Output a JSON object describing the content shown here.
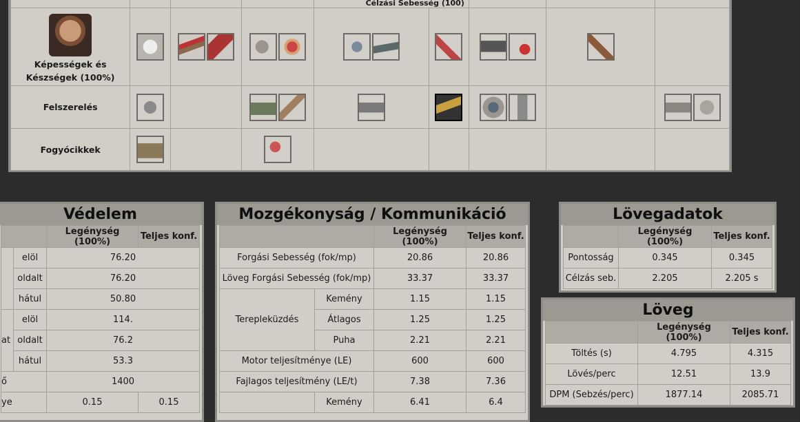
{
  "top_table": {
    "partial_header": "Célzási Sebesség (100)",
    "rows": [
      {
        "label": "Képességek és Készségek (100%)"
      },
      {
        "label": "Felszerelés"
      },
      {
        "label": "Fogyócikkek"
      }
    ]
  },
  "vedelem": {
    "title": "Védelem",
    "headers": [
      "Legénység (100%)",
      "Teljes konf."
    ],
    "rows": [
      {
        "side": "elöl",
        "v1": "76.20",
        "v2": ""
      },
      {
        "side": "oldalt",
        "v1": "76.20",
        "v2": ""
      },
      {
        "side": "hátul",
        "v1": "50.80",
        "v2": ""
      },
      {
        "side": "elöl",
        "v1": "114.",
        "v2": ""
      },
      {
        "group": "at",
        "side": "oldalt",
        "v1": "76.2",
        "v2": ""
      },
      {
        "side": "hátul",
        "v1": "53.3",
        "v2": ""
      },
      {
        "label": "ő",
        "v1": "1400"
      },
      {
        "label": "ye",
        "v1": "0.15",
        "v2": "0.15"
      }
    ]
  },
  "mozg": {
    "title": "Mozgékonyság / Kommunikáció",
    "headers": [
      "Legénység (100%)",
      "Teljes konf."
    ],
    "rows": [
      {
        "label": "Forgási Sebesség (fok/mp)",
        "v1": "20.86",
        "v2": "20.86"
      },
      {
        "label": "Löveg Forgási Sebesség (fok/mp)",
        "v1": "33.37",
        "v2": "33.37"
      },
      {
        "group": "Terepleküzdés",
        "sub": "Kemény",
        "v1": "1.15",
        "v2": "1.15"
      },
      {
        "sub": "Átlagos",
        "v1": "1.25",
        "v2": "1.25"
      },
      {
        "sub": "Puha",
        "v1": "2.21",
        "v2": "2.21"
      },
      {
        "label": "Motor teljesítménye (LE)",
        "v1": "600",
        "v2": "600"
      },
      {
        "label": "Fajlagos teljesítmény (LE/t)",
        "v1": "7.38",
        "v2": "7.36"
      },
      {
        "sub": "Kemény",
        "v1": "6.41",
        "v2": "6.4"
      }
    ]
  },
  "lovegadatok": {
    "title": "Lövegadatok",
    "headers": [
      "Legénység (100%)",
      "Teljes konf."
    ],
    "rows": [
      {
        "label": "Pontosság",
        "v1": "0.345",
        "v2": "0.345"
      },
      {
        "label": "Célzás seb.",
        "v1": "2.205",
        "v2": "2.205 s"
      }
    ]
  },
  "loveg": {
    "title": "Löveg",
    "headers": [
      "Legénység (100%)",
      "Teljes konf."
    ],
    "rows": [
      {
        "label": "Töltés (s)",
        "v1": "4.795",
        "v2": "4.315"
      },
      {
        "label": "Lövés/perc",
        "v1": "12.51",
        "v2": "13.9"
      },
      {
        "label": "DPM (Sebzés/perc)",
        "v1": "1877.14",
        "v2": "2085.71"
      }
    ]
  }
}
